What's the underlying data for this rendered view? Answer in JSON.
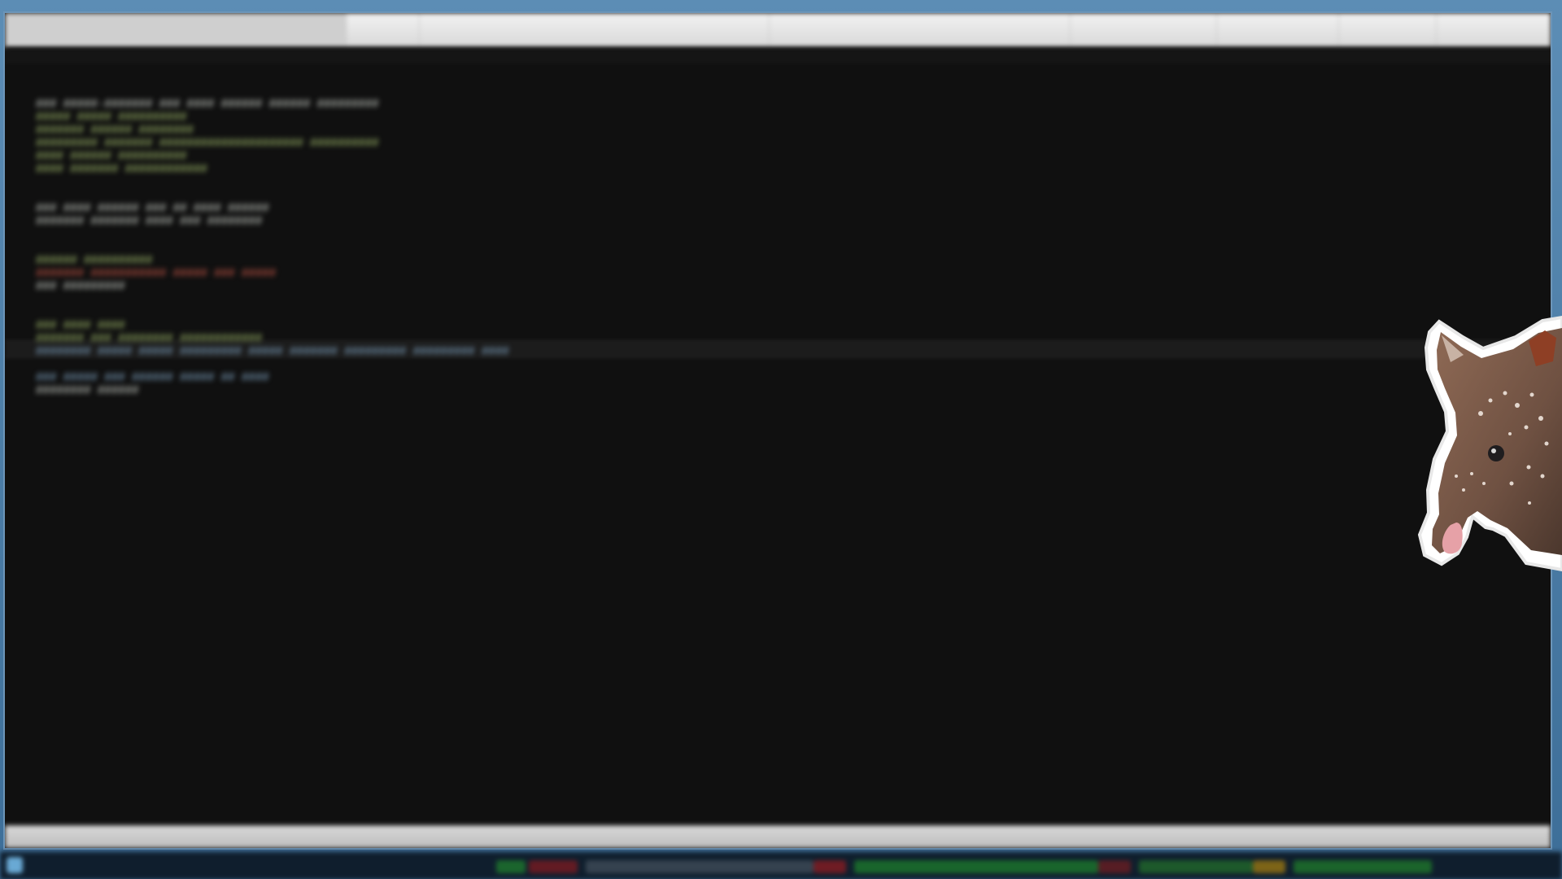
{
  "window": {
    "title": "",
    "tabs": [
      {
        "label": ""
      },
      {
        "label": ""
      },
      {
        "label": ""
      },
      {
        "label": ""
      },
      {
        "label": ""
      },
      {
        "label": ""
      },
      {
        "label": ""
      },
      {
        "label": ""
      }
    ],
    "status_text": ""
  },
  "editor": {
    "lines": [
      {
        "text": "### #####-####### ### #### ###### ###### #########"
      },
      {
        "text": "##### ##### ##########"
      },
      {
        "text": "####### ###### ########"
      },
      {
        "text": "######### ####### ##################### ##########"
      },
      {
        "text": "#### ###### ##########"
      },
      {
        "text": "#### ####### ############"
      },
      {
        "text": "### #### ###### ### ## #### ######"
      },
      {
        "text": "####### ####### #### ### ########"
      },
      {
        "text": "###### ##########"
      },
      {
        "text": "####### ########### ##### ### #####"
      },
      {
        "text": "### #########"
      },
      {
        "text": "### #### ####"
      },
      {
        "text": "####### ### ######## ############"
      },
      {
        "text": "######## ##### ##### ######### ##### ####### ######### ######### ####"
      },
      {
        "text": "### ##### ### ###### ##### ## ####"
      },
      {
        "text": "######## ######"
      }
    ]
  },
  "colors": {
    "background": "#101010",
    "tabbar": "#e6e6e6",
    "window_border": "#6c95b8",
    "text_primary": "#a7aba5",
    "text_green": "#8aa05d",
    "text_blue": "#6f8ea8",
    "text_red": "#a64a3d",
    "taskbar": "#0f1e2d"
  },
  "icons": {
    "start_button": "windows-start-icon",
    "sticker": "tapir-sticker"
  }
}
